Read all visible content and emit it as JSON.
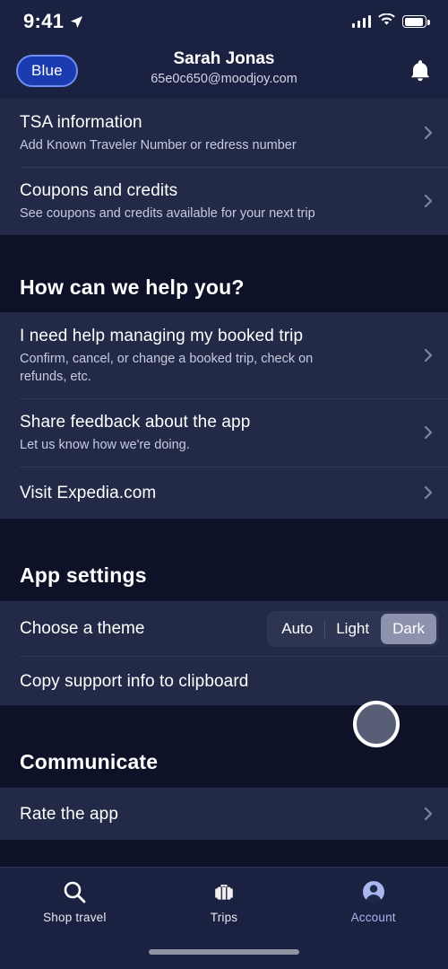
{
  "status_bar": {
    "time": "9:41",
    "location_icon": "location-arrow-icon",
    "signal_icon": "cellular-signal-icon",
    "wifi_icon": "wifi-icon",
    "battery_icon": "battery-full-icon"
  },
  "header": {
    "badge_label": "Blue",
    "user_name": "Sarah Jonas",
    "user_email": "65e0c650@moodjoy.com",
    "notification_icon": "bell-icon"
  },
  "account_section": {
    "rows": [
      {
        "title": "TSA information",
        "subtitle": "Add Known Traveler Number or redress number",
        "chevron": "chevron-right-icon"
      },
      {
        "title": "Coupons and credits",
        "subtitle": "See coupons and credits available for your next trip",
        "chevron": "chevron-right-icon"
      }
    ]
  },
  "help_section": {
    "heading": "How can we help you?",
    "rows": [
      {
        "title": "I need help managing my booked trip",
        "subtitle": "Confirm, cancel, or change a booked trip, check on refunds, etc.",
        "chevron": "chevron-right-icon"
      },
      {
        "title": "Share feedback about the app",
        "subtitle": "Let us know how we're doing.",
        "chevron": "chevron-right-icon"
      },
      {
        "title": "Visit Expedia.com",
        "subtitle": "",
        "chevron": "chevron-right-icon"
      }
    ]
  },
  "app_settings_section": {
    "heading": "App settings",
    "theme_label": "Choose a theme",
    "theme_options": [
      "Auto",
      "Light",
      "Dark"
    ],
    "theme_selected": "Dark",
    "copy_support_label": "Copy support info to clipboard"
  },
  "communicate_section": {
    "heading": "Communicate",
    "rows": [
      {
        "title": "Rate the app",
        "chevron": "chevron-right-icon"
      }
    ]
  },
  "tab_bar": {
    "tabs": [
      {
        "label": "Shop travel",
        "icon": "search-icon",
        "active": false
      },
      {
        "label": "Trips",
        "icon": "suitcase-icon",
        "active": false
      },
      {
        "label": "Account",
        "icon": "account-avatar-icon",
        "active": true
      }
    ]
  },
  "overlay": {
    "tap_indicator": "tap-ring-cursor"
  },
  "colors": {
    "page_background": "#0d1228",
    "row_background": "#232a47",
    "header_background": "#1b2140",
    "accent_blue": "#1b3bb0",
    "badge_border": "#6f8ff5",
    "active_tab": "#aab6ef",
    "segment_active": "#8d92ad",
    "divider": "#343b59"
  }
}
